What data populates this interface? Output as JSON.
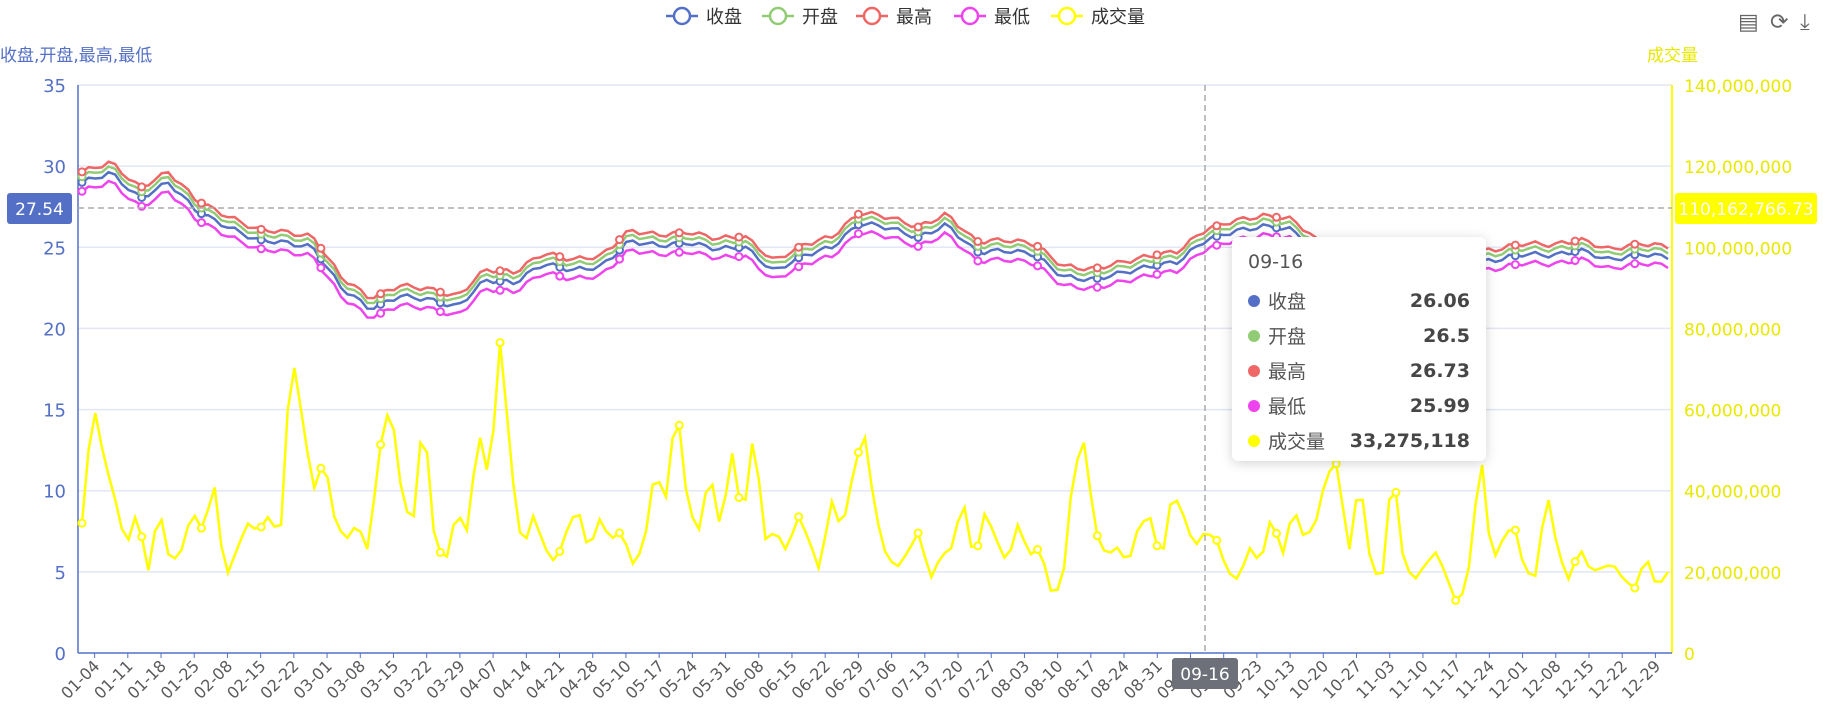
{
  "chart_data": {
    "type": "line",
    "legend": {
      "position": "top-center",
      "items": [
        "收盘",
        "开盘",
        "最高",
        "最低",
        "成交量"
      ]
    },
    "y_left": {
      "label": "收盘,开盘,最高,最低",
      "min": 0,
      "max": 35,
      "ticks": [
        0,
        5,
        10,
        15,
        20,
        25,
        30,
        35
      ]
    },
    "y_right": {
      "label": "成交量",
      "min": 0,
      "max": 140000000,
      "ticks": [
        "0",
        "20,000,000",
        "40,000,000",
        "60,000,000",
        "80,000,000",
        "100,000,000",
        "120,000,000",
        "140,000,000"
      ]
    },
    "x_tick_labels": [
      "01-04",
      "01-11",
      "01-18",
      "01-25",
      "02-08",
      "02-15",
      "02-22",
      "03-01",
      "03-08",
      "03-15",
      "03-22",
      "03-29",
      "04-07",
      "04-14",
      "04-21",
      "04-28",
      "05-10",
      "05-17",
      "05-24",
      "05-31",
      "06-08",
      "06-15",
      "06-22",
      "06-29",
      "07-06",
      "07-13",
      "07-20",
      "07-27",
      "08-03",
      "08-10",
      "08-17",
      "08-24",
      "08-31",
      "09-07",
      "09-16",
      "09-23",
      "10-13",
      "10-20",
      "10-27",
      "11-03",
      "11-10",
      "11-17",
      "11-24",
      "12-01",
      "12-08",
      "12-15",
      "12-22",
      "12-29"
    ],
    "close_anchors": [
      29.0,
      29.6,
      28.0,
      29.0,
      27.2,
      26.3,
      25.5,
      25.3,
      25.0,
      22.5,
      21.2,
      22.0,
      21.8,
      21.3,
      23.0,
      22.8,
      24.0,
      23.6,
      23.8,
      25.4,
      25.1,
      25.3,
      24.9,
      25.0,
      23.5,
      24.5,
      25.0,
      26.5,
      26.2,
      25.6,
      26.4,
      24.7,
      24.8,
      24.6,
      23.2,
      23.0,
      23.4,
      23.8,
      24.1,
      25.5,
      26.0,
      26.3,
      26.06,
      24.5,
      24.0,
      24.4,
      24.6,
      24.3,
      24.0,
      24.2,
      24.6,
      24.5,
      24.8,
      24.2,
      24.6,
      24.4
    ],
    "volume_anchors": [
      32000000,
      62000000,
      48000000,
      38000000,
      26000000,
      35000000,
      20000000,
      36000000,
      22000000,
      25000000,
      35000000,
      30000000,
      42000000,
      18000000,
      25000000,
      32000000,
      30000000,
      34000000,
      28000000,
      75000000,
      58000000,
      40000000,
      48000000,
      32000000,
      28000000,
      32000000,
      25000000,
      50000000,
      62000000,
      40000000,
      30000000,
      60000000,
      28000000,
      22000000,
      35000000,
      30000000,
      55000000,
      42000000,
      78000000,
      45000000,
      25000000,
      34000000,
      26000000,
      22000000,
      30000000,
      36000000,
      25000000,
      33000000,
      28000000,
      30000000,
      22000000,
      26000000,
      45000000,
      38000000,
      62000000,
      36000000,
      30000000,
      45000000,
      30000000,
      50000000,
      32000000,
      55000000,
      28000000,
      30000000,
      25000000,
      34000000,
      28000000,
      20000000,
      38000000,
      30000000,
      44000000,
      55000000,
      35000000,
      24000000,
      21000000,
      25000000,
      30000000,
      18000000,
      24000000,
      26000000,
      38000000,
      22000000,
      35000000,
      28000000,
      22000000,
      32000000,
      24000000,
      26000000,
      15000000,
      16000000,
      45000000,
      52000000,
      30000000,
      24000000,
      26000000,
      22000000,
      32000000,
      33275118,
      22000000,
      40000000,
      34000000,
      26000000,
      30000000,
      28000000,
      20000000,
      18000000,
      26000000,
      22000000,
      34000000,
      24000000,
      36000000,
      28000000,
      32000000,
      44000000,
      47000000,
      24000000,
      44000000,
      22000000,
      17000000,
      47000000,
      22000000,
      18000000,
      22000000,
      25000000,
      18000000,
      11000000,
      22000000,
      50000000,
      22000000,
      28000000,
      32000000,
      20000000,
      19000000,
      40000000,
      25000000,
      18000000,
      26000000,
      20000000,
      21000000,
      22000000,
      18000000,
      16000000,
      24000000,
      16000000,
      20000000
    ],
    "series": [
      {
        "name": "收盘",
        "color": "#5470c6",
        "offset": 0.0
      },
      {
        "name": "开盘",
        "color": "#91cc75",
        "offset": 0.35
      },
      {
        "name": "最高",
        "color": "#ee6666",
        "offset": 0.65
      },
      {
        "name": "最低",
        "color": "#ee44ee",
        "offset": -0.55
      },
      {
        "name": "成交量",
        "color": "#ffff00",
        "axis": "right"
      }
    ],
    "crosshair": {
      "x_label": "09-16",
      "y_left_label": "27.54",
      "y_right_label": "110,162,766.73"
    },
    "tooltip": {
      "title": "09-16",
      "rows": [
        {
          "name": "收盘",
          "value": "26.06",
          "color": "#5470c6"
        },
        {
          "name": "开盘",
          "value": "26.5",
          "color": "#91cc75"
        },
        {
          "name": "最高",
          "value": "26.73",
          "color": "#ee6666"
        },
        {
          "name": "最低",
          "value": "25.99",
          "color": "#ee44ee"
        },
        {
          "name": "成交量",
          "value": "33,275,118",
          "color": "#ffff00"
        }
      ]
    }
  },
  "toolbox": [
    {
      "name": "data-view-icon",
      "glyph": "▤"
    },
    {
      "name": "restore-icon",
      "glyph": "⟳"
    },
    {
      "name": "save-image-icon",
      "glyph": "⤓"
    }
  ]
}
